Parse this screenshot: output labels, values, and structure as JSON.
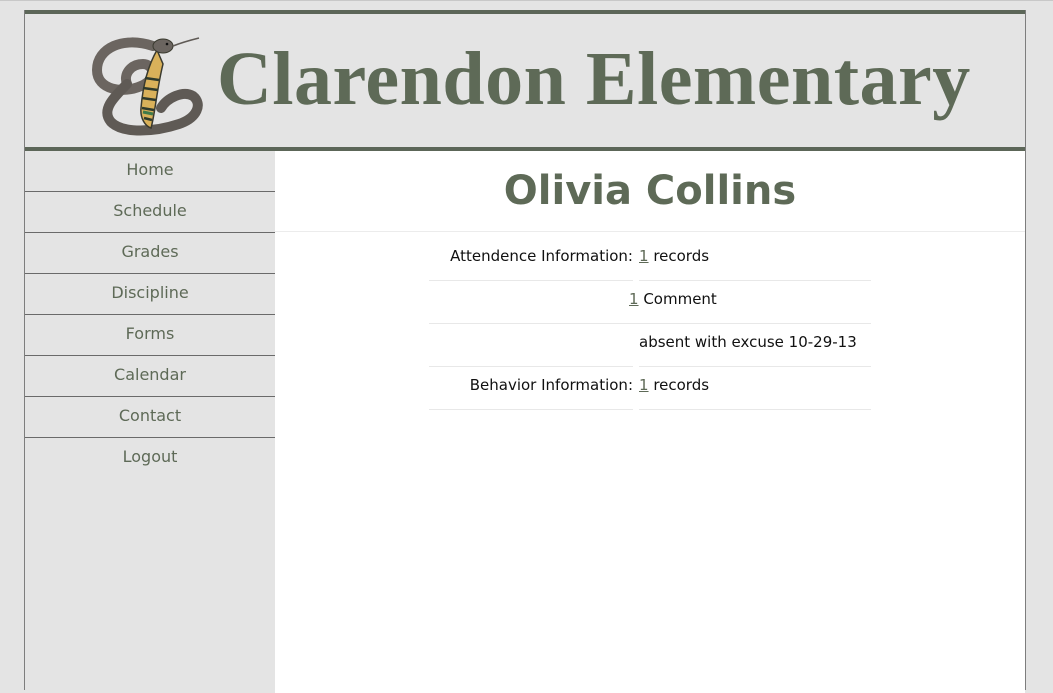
{
  "header": {
    "title": "Clarendon Elementary",
    "logo_icon": "cobra-snake-logo-icon"
  },
  "sidebar": {
    "items": [
      {
        "label": "Home"
      },
      {
        "label": "Schedule"
      },
      {
        "label": "Grades"
      },
      {
        "label": "Discipline"
      },
      {
        "label": "Forms"
      },
      {
        "label": "Calendar"
      },
      {
        "label": "Contact"
      },
      {
        "label": "Logout"
      }
    ]
  },
  "main": {
    "student_name": "Olivia Collins",
    "rows": [
      {
        "label": "Attendence Information:",
        "count": "1",
        "suffix": " records"
      },
      {
        "label": "",
        "count": "1",
        "suffix": " Comment"
      },
      {
        "label": "",
        "count": "",
        "suffix": "absent with excuse 10-29-13"
      },
      {
        "label": "Behavior Information:",
        "count": "1",
        "suffix": " records"
      }
    ]
  },
  "colors": {
    "accent": "#5e6a57",
    "header_bg": "#e4e4e4",
    "border": "#5c6658"
  }
}
